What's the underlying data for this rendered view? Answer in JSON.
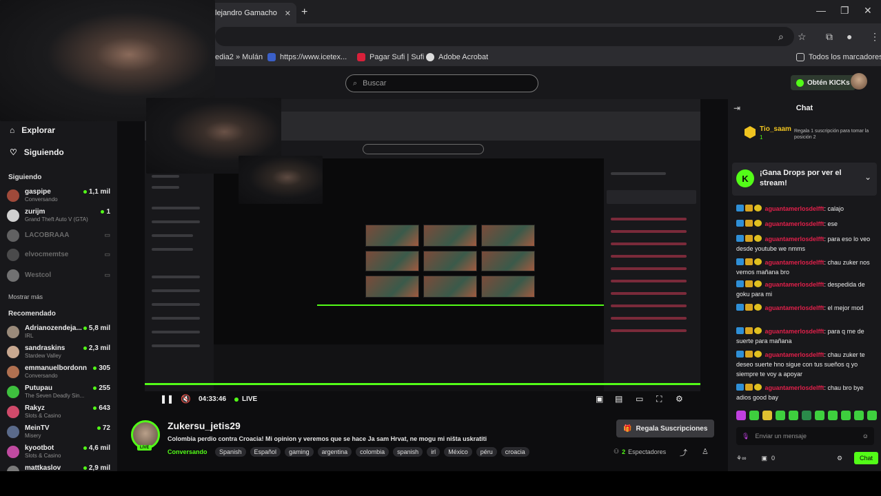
{
  "browser": {
    "tab_title": "lejandro Gamacho",
    "bookmarks": [
      "edia2 » Mulán",
      "https://www.icetex...",
      "Pagar Sufi | Sufi",
      "Adobe Acrobat"
    ],
    "all_bookmarks": "Todos los marcadores"
  },
  "header": {
    "search_placeholder": "Buscar",
    "kicks_button": "Obtén KICKs"
  },
  "sidebar": {
    "explore": "Explorar",
    "following_nav": "Siguiendo",
    "following_title": "Siguiendo",
    "following": [
      {
        "name": "gaspipe",
        "sub": "Conversando",
        "viewers": "1,1 mil",
        "online": true
      },
      {
        "name": "zurijm",
        "sub": "Grand Theft Auto V (GTA)",
        "viewers": "1",
        "online": true
      },
      {
        "name": "LACOBRAAA",
        "sub": "",
        "viewers": "",
        "online": false
      },
      {
        "name": "elvocmemtse",
        "sub": "",
        "viewers": "",
        "online": false
      },
      {
        "name": "Westcol",
        "sub": "",
        "viewers": "",
        "online": false
      }
    ],
    "show_more": "Mostrar más",
    "recommended_title": "Recomendado",
    "recommended": [
      {
        "name": "Adrianozendeja...",
        "sub": "IRL",
        "viewers": "5,8 mil"
      },
      {
        "name": "sandraskins",
        "sub": "Stardew Valley",
        "viewers": "2,3 mil"
      },
      {
        "name": "emmanuelbordonn",
        "sub": "Conversando",
        "viewers": "305"
      },
      {
        "name": "Putupau",
        "sub": "The Seven Deadly Sin...",
        "viewers": "255"
      },
      {
        "name": "Rakyz",
        "sub": "Slots & Casino",
        "viewers": "643"
      },
      {
        "name": "MeinTV",
        "sub": "Misery",
        "viewers": "72"
      },
      {
        "name": "kyootbot",
        "sub": "Slots & Casino",
        "viewers": "4,6 mil"
      },
      {
        "name": "mattkaslov",
        "sub": "",
        "viewers": "2,9 mil"
      }
    ]
  },
  "player": {
    "time": "04:33:46",
    "live_label": "LIVE"
  },
  "stream": {
    "channel": "Zukersu_jetis29",
    "live_badge": "LIVE",
    "title": "Colombia perdio contra Croacia! Mi opinion y veremos que se hace Ja sam Hrvat, ne mogu mi ništa uskratiti",
    "category": "Conversando",
    "tags": [
      "Spanish",
      "Español",
      "gaming",
      "argentina",
      "colombia",
      "spanish",
      "irl",
      "México",
      "péru",
      "croacia"
    ],
    "subscribe_button": "Regala Suscripciones",
    "viewer_count": "2",
    "viewer_label": "Espectadores"
  },
  "chat": {
    "title": "Chat",
    "pinned_user": "Tio_saam",
    "pinned_count": "1",
    "pinned_note": "Regala 1 suscripción para tomar la posición 2",
    "drops_text": "¡Gana Drops por ver el stream!",
    "messages": [
      {
        "user": "aguantamerlosdelfft",
        "text": "calajo"
      },
      {
        "user": "aguantamerlosdelfft",
        "text": "ese"
      },
      {
        "user": "aguantamerlosdelfft",
        "text": "para eso lo veo desde youtube we nmms"
      },
      {
        "user": "aguantamerlosdelfft",
        "text": "chau zuker nos vemos mañana bro"
      },
      {
        "user": "aguantamerlosdelfft",
        "text": "despedida de goku para mi"
      },
      {
        "user": "aguantamerlosdelfft",
        "text": "el mejor mod"
      },
      {
        "user": "aguantamerlosdelfft",
        "text": "para q me de suerte para mañana"
      },
      {
        "user": "aguantamerlosdelfft",
        "text": "chau zuker te deseo suerte hno sigue con tus sueños q yo siempre te voy a apoyar"
      },
      {
        "user": "aguantamerlosdelfft",
        "text": "chau bro bye adios good bay"
      }
    ],
    "input_placeholder": "Enviar un mensaje",
    "points": "0",
    "send_button": "Chat"
  },
  "icons": {
    "search": "search-icon",
    "explore": "home-icon",
    "following": "heart-icon"
  },
  "colors": {
    "accent": "#53fc18",
    "chat_username": "#e0204a",
    "background": "#18181b"
  }
}
